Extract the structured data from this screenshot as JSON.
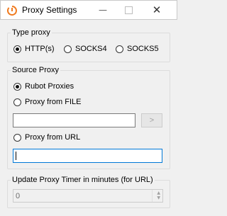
{
  "window": {
    "title": "Proxy Settings",
    "icon": "app-logo-icon",
    "accent_color": "#f07a1e"
  },
  "type_proxy": {
    "legend": "Type proxy",
    "options": [
      {
        "label": "HTTP(s)",
        "checked": true
      },
      {
        "label": "SOCKS4",
        "checked": false
      },
      {
        "label": "SOCKS5",
        "checked": false
      }
    ]
  },
  "source_proxy": {
    "legend": "Source Proxy",
    "rubot_label": "Rubot Proxies",
    "rubot_checked": true,
    "file_label": "Proxy from FILE",
    "file_checked": false,
    "file_path_value": "",
    "browse_label": ">",
    "url_label": "Proxy from URL",
    "url_checked": false,
    "url_value": ""
  },
  "update_timer": {
    "legend": "Update Proxy Timer in minutes (for URL)",
    "value": "0"
  }
}
